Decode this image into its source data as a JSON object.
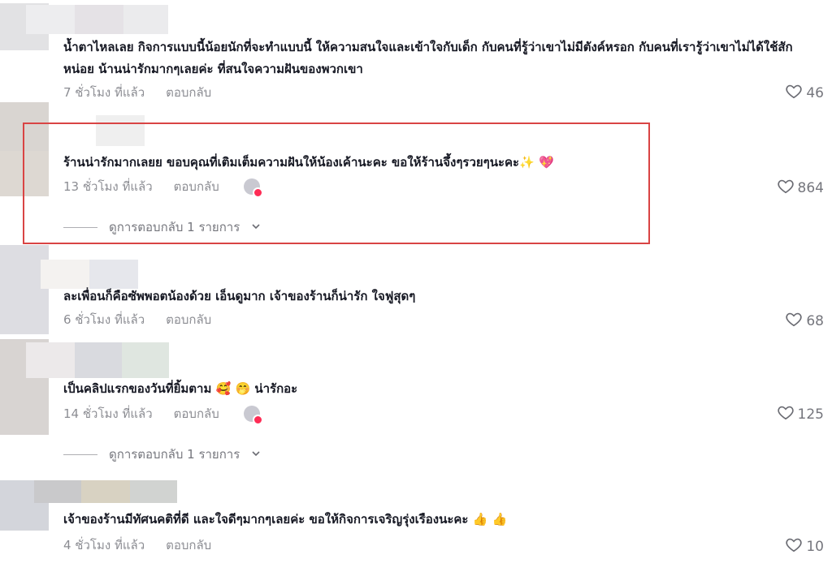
{
  "theme": {
    "highlight": "#d94444",
    "creator_badge": "#fe2c55"
  },
  "comments": [
    {
      "text": "น้ำตาไหลเลย กิจการแบบนี้น้อยนักที่จะทำแบบนี้ ให้ความสนใจและเข้าใจกับเด็ก กับคนที่รู้ว่าเขาไม่มีตังค์หรอก กับคนที่เรารู้ว่าเขาไม่ได้ใช้สักหน่อย น้านน่ารักมากๆเลยค่ะ ที่สนใจความฝันของพวกเขา",
      "time": "7 ชั่วโมง ที่แล้ว",
      "reply_label": "ตอบกลับ",
      "likes": "46"
    },
    {
      "text": "ร้านน่ารักมากเลยย ขอบคุณที่เติมเต็มความฝันให้น้องเค้านะคะ ขอให้ร้านจึ้งๆรวยๆนะคะ✨ 💖",
      "time": "13 ชั่วโมง ที่แล้ว",
      "reply_label": "ตอบกลับ",
      "likes": "864",
      "view_replies": "ดูการตอบกลับ 1 รายการ"
    },
    {
      "text": "ละเพื่อนก็คือซัพพอตน้องด้วย เอ็นดูมาก เจ้าของร้านก็น่ารัก ใจฟูสุดๆ",
      "time": "6 ชั่วโมง ที่แล้ว",
      "reply_label": "ตอบกลับ",
      "likes": "68"
    },
    {
      "text": "เป็นคลิปแรกของวันที่ยิ้มตาม 🥰 🤭 น่ารักอะ",
      "time": "14 ชั่วโมง ที่แล้ว",
      "reply_label": "ตอบกลับ",
      "likes": "125",
      "view_replies": "ดูการตอบกลับ 1 รายการ"
    },
    {
      "text": "เจ้าของร้านมีทัศนคติที่ดี และใจดีๆมากๆเลยค่ะ ขอให้กิจการเจริญรุ่งเรืองนะคะ 👍 👍",
      "time": "4 ชั่วโมง ที่แล้ว",
      "reply_label": "ตอบกลับ",
      "likes": "10"
    }
  ]
}
